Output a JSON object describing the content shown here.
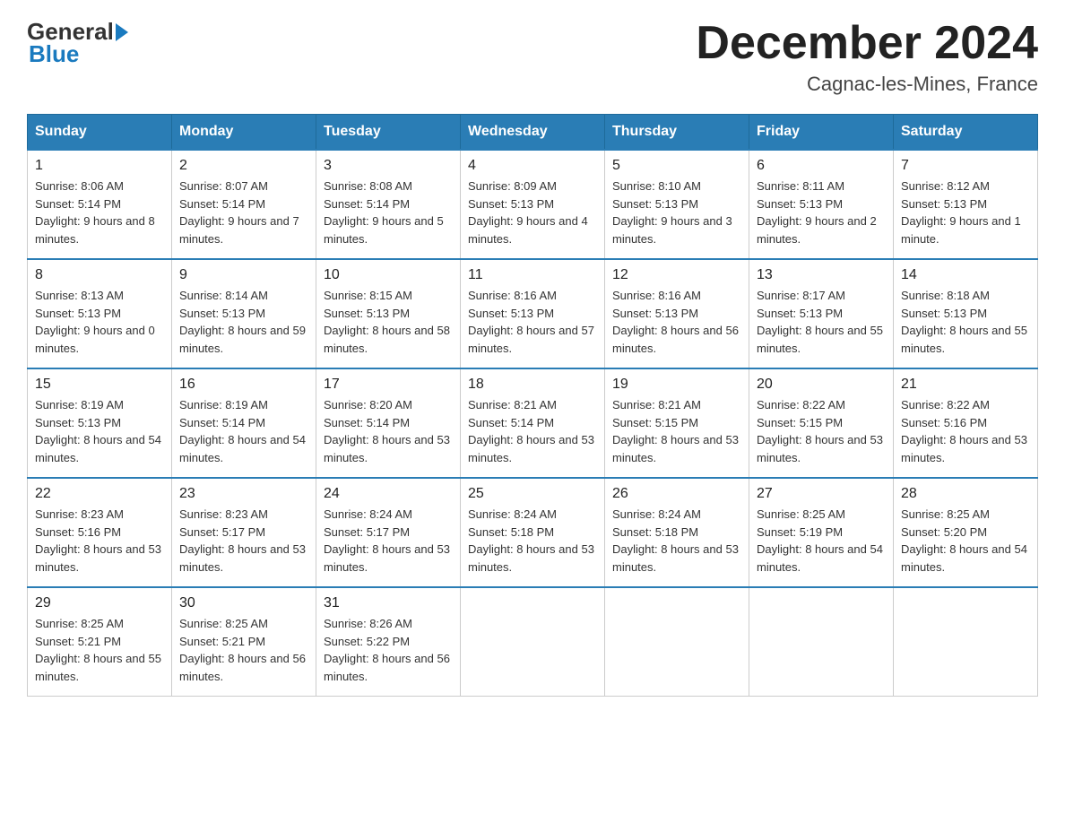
{
  "logo": {
    "general": "General",
    "blue": "Blue"
  },
  "header": {
    "month": "December 2024",
    "location": "Cagnac-les-Mines, France"
  },
  "weekdays": [
    "Sunday",
    "Monday",
    "Tuesday",
    "Wednesday",
    "Thursday",
    "Friday",
    "Saturday"
  ],
  "weeks": [
    [
      {
        "day": "1",
        "sunrise": "8:06 AM",
        "sunset": "5:14 PM",
        "daylight": "9 hours and 8 minutes."
      },
      {
        "day": "2",
        "sunrise": "8:07 AM",
        "sunset": "5:14 PM",
        "daylight": "9 hours and 7 minutes."
      },
      {
        "day": "3",
        "sunrise": "8:08 AM",
        "sunset": "5:14 PM",
        "daylight": "9 hours and 5 minutes."
      },
      {
        "day": "4",
        "sunrise": "8:09 AM",
        "sunset": "5:13 PM",
        "daylight": "9 hours and 4 minutes."
      },
      {
        "day": "5",
        "sunrise": "8:10 AM",
        "sunset": "5:13 PM",
        "daylight": "9 hours and 3 minutes."
      },
      {
        "day": "6",
        "sunrise": "8:11 AM",
        "sunset": "5:13 PM",
        "daylight": "9 hours and 2 minutes."
      },
      {
        "day": "7",
        "sunrise": "8:12 AM",
        "sunset": "5:13 PM",
        "daylight": "9 hours and 1 minute."
      }
    ],
    [
      {
        "day": "8",
        "sunrise": "8:13 AM",
        "sunset": "5:13 PM",
        "daylight": "9 hours and 0 minutes."
      },
      {
        "day": "9",
        "sunrise": "8:14 AM",
        "sunset": "5:13 PM",
        "daylight": "8 hours and 59 minutes."
      },
      {
        "day": "10",
        "sunrise": "8:15 AM",
        "sunset": "5:13 PM",
        "daylight": "8 hours and 58 minutes."
      },
      {
        "day": "11",
        "sunrise": "8:16 AM",
        "sunset": "5:13 PM",
        "daylight": "8 hours and 57 minutes."
      },
      {
        "day": "12",
        "sunrise": "8:16 AM",
        "sunset": "5:13 PM",
        "daylight": "8 hours and 56 minutes."
      },
      {
        "day": "13",
        "sunrise": "8:17 AM",
        "sunset": "5:13 PM",
        "daylight": "8 hours and 55 minutes."
      },
      {
        "day": "14",
        "sunrise": "8:18 AM",
        "sunset": "5:13 PM",
        "daylight": "8 hours and 55 minutes."
      }
    ],
    [
      {
        "day": "15",
        "sunrise": "8:19 AM",
        "sunset": "5:13 PM",
        "daylight": "8 hours and 54 minutes."
      },
      {
        "day": "16",
        "sunrise": "8:19 AM",
        "sunset": "5:14 PM",
        "daylight": "8 hours and 54 minutes."
      },
      {
        "day": "17",
        "sunrise": "8:20 AM",
        "sunset": "5:14 PM",
        "daylight": "8 hours and 53 minutes."
      },
      {
        "day": "18",
        "sunrise": "8:21 AM",
        "sunset": "5:14 PM",
        "daylight": "8 hours and 53 minutes."
      },
      {
        "day": "19",
        "sunrise": "8:21 AM",
        "sunset": "5:15 PM",
        "daylight": "8 hours and 53 minutes."
      },
      {
        "day": "20",
        "sunrise": "8:22 AM",
        "sunset": "5:15 PM",
        "daylight": "8 hours and 53 minutes."
      },
      {
        "day": "21",
        "sunrise": "8:22 AM",
        "sunset": "5:16 PM",
        "daylight": "8 hours and 53 minutes."
      }
    ],
    [
      {
        "day": "22",
        "sunrise": "8:23 AM",
        "sunset": "5:16 PM",
        "daylight": "8 hours and 53 minutes."
      },
      {
        "day": "23",
        "sunrise": "8:23 AM",
        "sunset": "5:17 PM",
        "daylight": "8 hours and 53 minutes."
      },
      {
        "day": "24",
        "sunrise": "8:24 AM",
        "sunset": "5:17 PM",
        "daylight": "8 hours and 53 minutes."
      },
      {
        "day": "25",
        "sunrise": "8:24 AM",
        "sunset": "5:18 PM",
        "daylight": "8 hours and 53 minutes."
      },
      {
        "day": "26",
        "sunrise": "8:24 AM",
        "sunset": "5:18 PM",
        "daylight": "8 hours and 53 minutes."
      },
      {
        "day": "27",
        "sunrise": "8:25 AM",
        "sunset": "5:19 PM",
        "daylight": "8 hours and 54 minutes."
      },
      {
        "day": "28",
        "sunrise": "8:25 AM",
        "sunset": "5:20 PM",
        "daylight": "8 hours and 54 minutes."
      }
    ],
    [
      {
        "day": "29",
        "sunrise": "8:25 AM",
        "sunset": "5:21 PM",
        "daylight": "8 hours and 55 minutes."
      },
      {
        "day": "30",
        "sunrise": "8:25 AM",
        "sunset": "5:21 PM",
        "daylight": "8 hours and 56 minutes."
      },
      {
        "day": "31",
        "sunrise": "8:26 AM",
        "sunset": "5:22 PM",
        "daylight": "8 hours and 56 minutes."
      },
      null,
      null,
      null,
      null
    ]
  ],
  "labels": {
    "sunrise": "Sunrise:",
    "sunset": "Sunset:",
    "daylight": "Daylight:"
  }
}
